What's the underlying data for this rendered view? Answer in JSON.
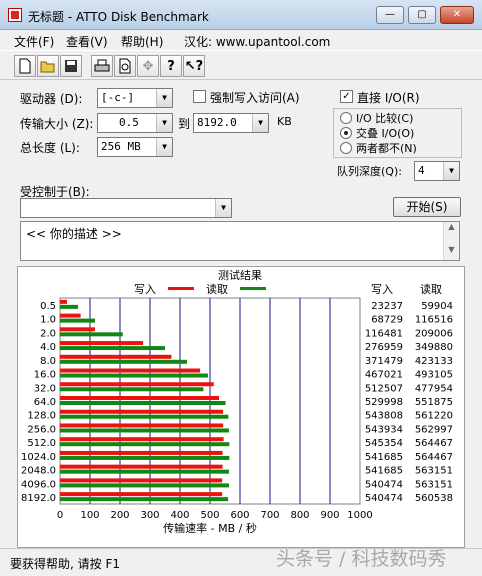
{
  "window": {
    "title": "无标题 - ATTO Disk Benchmark",
    "minimize": "—",
    "maximize": "▢",
    "close": "✕"
  },
  "menu": {
    "file": "文件(F)",
    "view": "查看(V)",
    "help": "帮助(H)",
    "site": "汉化: www.upantool.com"
  },
  "toolbar": [
    "new-file-icon",
    "open-folder-icon",
    "save-icon",
    "print-icon",
    "print-preview-icon",
    "move-icon",
    "help-icon",
    "context-help-icon"
  ],
  "form": {
    "drive_label": "驱动器 (D):",
    "drive_value": "[-c-]",
    "transfer_label": "传输大小 (Z):",
    "transfer_from": "0.5",
    "to_label": "到",
    "transfer_to": "8192.0",
    "kb_label": "KB",
    "length_label": "总长度 (L):",
    "length_value": "256 MB",
    "force_write_label": "强制写入访问(A)",
    "direct_io_label": "直接 I/O(R)",
    "io_compare_label": "I/O 比较(C)",
    "overlapped_io_label": "交叠 I/O(O)",
    "neither_label": "两者都不(N)",
    "queue_label": "队列深度(Q):",
    "queue_value": "4",
    "controlled_by_label": "受控制于(B):",
    "controlled_by_value": "",
    "start_label": "开始(S)",
    "description": "<<  你的描述   >>"
  },
  "chart_data": {
    "type": "bar",
    "title": "测试结果",
    "xlabel": "传输速率 - MB / 秒",
    "xlim": [
      0,
      1000
    ],
    "xticks": [
      "0",
      "100",
      "200",
      "300",
      "400",
      "500",
      "600",
      "700",
      "800",
      "900",
      "1000"
    ],
    "categories": [
      "0.5",
      "1.0",
      "2.0",
      "4.0",
      "8.0",
      "16.0",
      "32.0",
      "64.0",
      "128.0",
      "256.0",
      "512.0",
      "1024.0",
      "2048.0",
      "4096.0",
      "8192.0"
    ],
    "series": [
      {
        "name": "写入",
        "color": "#ee1111",
        "values": [
          23.237,
          68.729,
          116.481,
          276.959,
          371.479,
          467.021,
          512.507,
          529.998,
          543.808,
          543.934,
          545.354,
          541.685,
          541.685,
          540.474,
          540.474
        ]
      },
      {
        "name": "读取",
        "color": "#118811",
        "values": [
          59.904,
          116.516,
          209.006,
          349.88,
          423.133,
          493.105,
          477.954,
          551.875,
          561.22,
          562.997,
          564.467,
          564.467,
          563.151,
          563.151,
          560.538
        ]
      }
    ],
    "write_header": "写入",
    "read_header": "读取",
    "write_col": [
      "23237",
      "68729",
      "116481",
      "276959",
      "371479",
      "467021",
      "512507",
      "529998",
      "543808",
      "543934",
      "545354",
      "541685",
      "541685",
      "540474",
      "540474"
    ],
    "read_col": [
      "59904",
      "116516",
      "209006",
      "349880",
      "423133",
      "493105",
      "477954",
      "551875",
      "561220",
      "562997",
      "564467",
      "564467",
      "563151",
      "563151",
      "560538"
    ]
  },
  "status": {
    "help_text": "要获得帮助, 请按 F1",
    "watermark": "头条号 / 科技数码秀"
  }
}
